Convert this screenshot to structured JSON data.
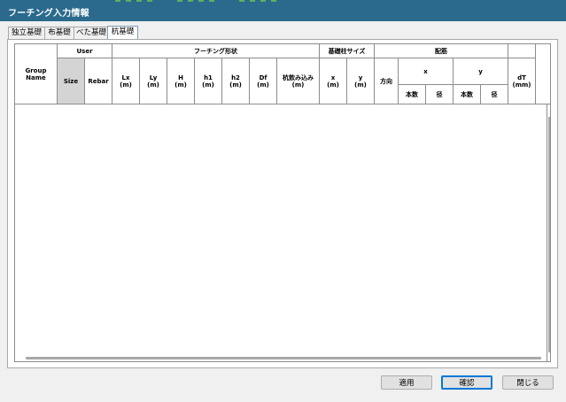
{
  "window": {
    "title": "フーチング入力情報",
    "close_glyph": "✕"
  },
  "tabs": [
    {
      "label": "独立基礎",
      "active": false
    },
    {
      "label": "布基礎",
      "active": false
    },
    {
      "label": "べた基礎",
      "active": false
    },
    {
      "label": "杭基礎",
      "active": true
    }
  ],
  "grid": {
    "group_name": "Group\nName",
    "user": "User",
    "size": "Size",
    "rebar": "Rebar",
    "footing_shape": "フーチング形状",
    "lx": "Lx\n(m)",
    "ly": "Ly\n(m)",
    "h": "H\n(m)",
    "h1": "h1\n(m)",
    "h2": "h2\n(m)",
    "df": "Df\n(m)",
    "embed": "杭飲み込み\n(m)",
    "column_size": "基礎柱サイズ",
    "col_x": "x\n(m)",
    "col_y": "y\n(m)",
    "bars": "配筋",
    "direction": "方向",
    "bar_x": "x",
    "bar_y": "y",
    "count_x": "本数",
    "dia_x": "径",
    "count_y": "本数",
    "dia_y": "径",
    "dt": "dT\n(mm)"
  },
  "buttons": {
    "apply": "適用",
    "confirm": "確認",
    "close": "閉じる"
  },
  "colors": {
    "titlebar": "#2b6a8c",
    "selected_header": "#d4d4d4",
    "primary_border": "#0078d7"
  }
}
